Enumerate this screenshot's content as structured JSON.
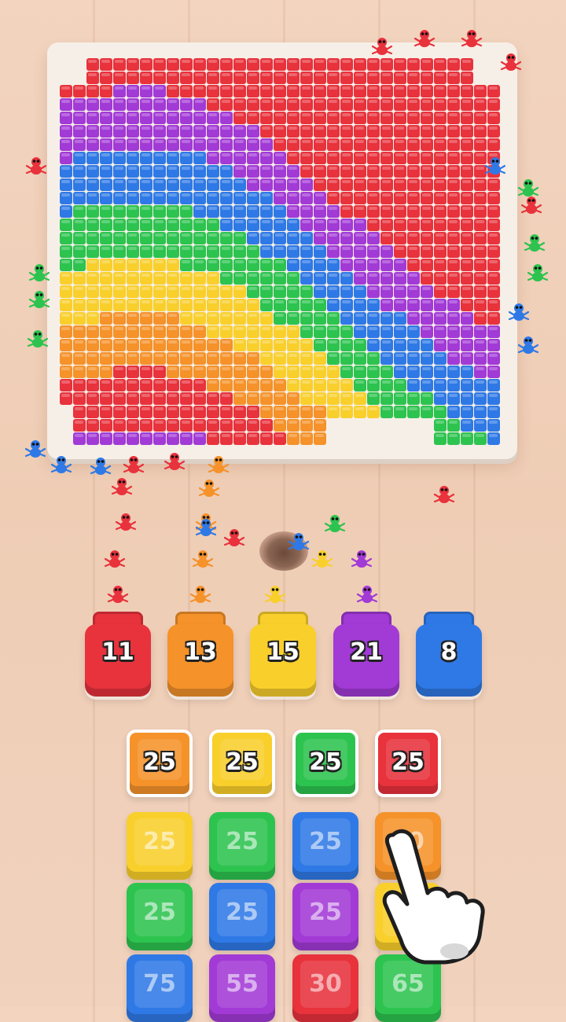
{
  "colors": {
    "red": "#e8323c",
    "orange": "#f5922a",
    "yellow": "#f9cf2c",
    "purple": "#a23ad6",
    "blue": "#2f79e6",
    "green": "#2dc34f",
    "board": "#f6efe8"
  },
  "board": {
    "bands_left_to_right_description": [
      "red",
      "purple",
      "blue",
      "green",
      "yellow",
      "orange",
      "red",
      "purple"
    ]
  },
  "bins": [
    {
      "color": "red",
      "count": "11"
    },
    {
      "color": "orange",
      "count": "13"
    },
    {
      "color": "yellow",
      "count": "15"
    },
    {
      "color": "purple",
      "count": "21"
    },
    {
      "color": "blue",
      "count": "8"
    }
  ],
  "tiles": [
    [
      {
        "color": "orange",
        "count": "25",
        "active": true
      },
      {
        "color": "yellow",
        "count": "25",
        "active": true
      },
      {
        "color": "green",
        "count": "25",
        "active": true
      },
      {
        "color": "red",
        "count": "25",
        "active": true
      }
    ],
    [
      {
        "color": "yellow",
        "count": "25",
        "active": false
      },
      {
        "color": "green",
        "count": "25",
        "active": false
      },
      {
        "color": "blue",
        "count": "25",
        "active": false
      },
      {
        "color": "orange",
        "count": "30",
        "active": false
      }
    ],
    [
      {
        "color": "green",
        "count": "25",
        "active": false
      },
      {
        "color": "blue",
        "count": "25",
        "active": false
      },
      {
        "color": "purple",
        "count": "25",
        "active": false
      },
      {
        "color": "yellow",
        "count": "",
        "active": false
      }
    ],
    [
      {
        "color": "blue",
        "count": "75",
        "active": false
      },
      {
        "color": "purple",
        "count": "55",
        "active": false
      },
      {
        "color": "red",
        "count": "30",
        "active": false
      },
      {
        "color": "green",
        "count": "65",
        "active": false
      }
    ]
  ],
  "icons": {
    "hand": "pointing-hand-icon",
    "ant": "ant-icon",
    "hole": "ant-hole-icon"
  }
}
